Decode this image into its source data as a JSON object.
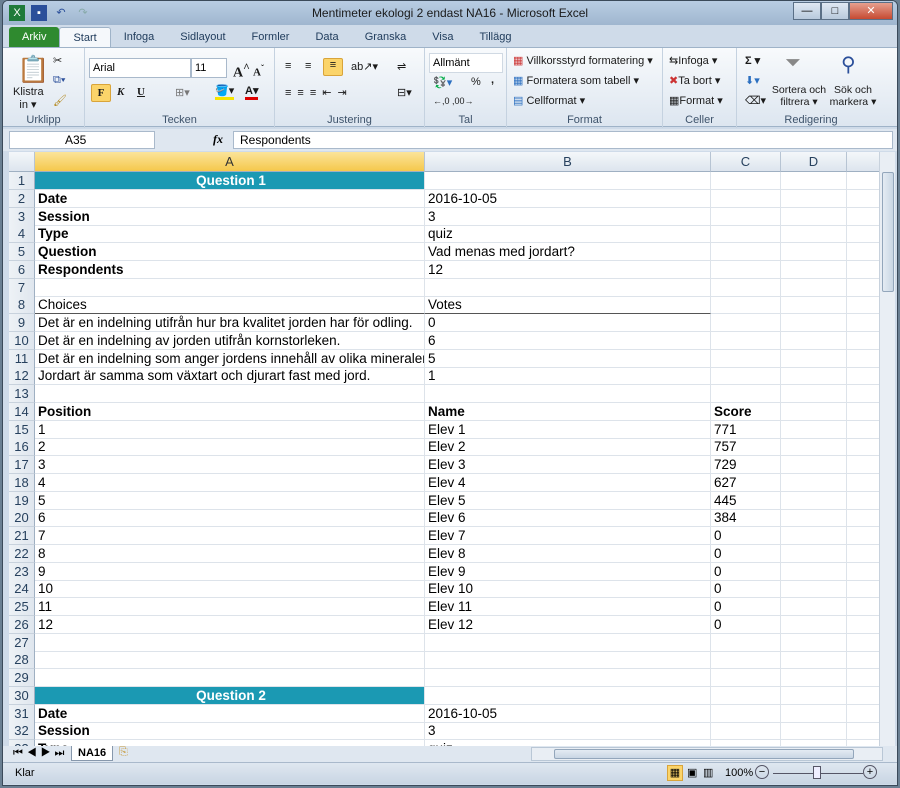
{
  "window": {
    "title": "Mentimeter ekologi 2 endast NA16  -  Microsoft Excel",
    "minimize": "—",
    "maximize": "□",
    "close": "✕"
  },
  "tabs": [
    "Arkiv",
    "Start",
    "Infoga",
    "Sidlayout",
    "Formler",
    "Data",
    "Granska",
    "Visa",
    "Tillägg"
  ],
  "ribbon": {
    "clipboard": {
      "label": "Urklipp",
      "paste": "Klistra in ▾"
    },
    "font": {
      "label": "Tecken",
      "name": "Arial",
      "size": "11",
      "bold": "F",
      "italic": "K",
      "underline": "U"
    },
    "alignment": {
      "label": "Justering"
    },
    "number": {
      "label": "Tal",
      "format": "Allmänt",
      "percent": "%",
      "comma": ","
    },
    "styles": {
      "label": "Format",
      "conditional": "Villkorsstyrd formatering ▾",
      "as_table": "Formatera som tabell ▾",
      "cell_styles": "Cellformat ▾"
    },
    "cells": {
      "label": "Celler",
      "insert": "Infoga ▾",
      "delete": "Ta bort ▾",
      "format": "Format ▾"
    },
    "editing": {
      "label": "Redigering",
      "sum": "Σ ▾",
      "sort": "Sortera och filtrera ▾",
      "find": "Sök och markera ▾"
    }
  },
  "formula_bar": {
    "name_box": "A35",
    "fx": "fx",
    "value": "Respondents"
  },
  "columns": [
    "A",
    "B",
    "C",
    "D"
  ],
  "rows": [
    {
      "n": "1",
      "a": "Question 1",
      "b": "",
      "c": "",
      "style": "heading"
    },
    {
      "n": "2",
      "a": "Date",
      "b": "2016-10-05",
      "c": "",
      "style": "label"
    },
    {
      "n": "3",
      "a": "Session",
      "b": "3",
      "c": "",
      "style": "label"
    },
    {
      "n": "4",
      "a": "Type",
      "b": "quiz",
      "c": "",
      "style": "label"
    },
    {
      "n": "5",
      "a": "Question",
      "b": "Vad menas med jordart?",
      "c": "",
      "style": "label"
    },
    {
      "n": "6",
      "a": "Respondents",
      "b": "12",
      "c": "",
      "style": "label"
    },
    {
      "n": "7",
      "a": "",
      "b": "",
      "c": "",
      "style": ""
    },
    {
      "n": "8",
      "a": "Choices",
      "b": "Votes",
      "c": "",
      "style": "choicehdr"
    },
    {
      "n": "9",
      "a": "Det är en indelning utifrån hur bra kvalitet jorden har för odling.",
      "b": "0",
      "c": "",
      "style": ""
    },
    {
      "n": "10",
      "a": "Det är en indelning av jorden utifrån kornstorleken.",
      "b": "6",
      "c": "",
      "style": ""
    },
    {
      "n": "11",
      "a": "Det är en indelning som anger jordens innehåll av olika mineraler",
      "b": "5",
      "c": "",
      "style": ""
    },
    {
      "n": "12",
      "a": "Jordart är samma som växtart och djurart fast med jord.",
      "b": "1",
      "c": "",
      "style": ""
    },
    {
      "n": "13",
      "a": "",
      "b": "",
      "c": "",
      "style": ""
    },
    {
      "n": "14",
      "a": "Position",
      "b": "Name",
      "c": "Score",
      "style": "bold"
    },
    {
      "n": "15",
      "a": "1",
      "b": "Elev 1",
      "c": "771",
      "style": ""
    },
    {
      "n": "16",
      "a": "2",
      "b": "Elev 2",
      "c": "757",
      "style": ""
    },
    {
      "n": "17",
      "a": "3",
      "b": "Elev 3",
      "c": "729",
      "style": ""
    },
    {
      "n": "18",
      "a": "4",
      "b": "Elev 4",
      "c": "627",
      "style": ""
    },
    {
      "n": "19",
      "a": "5",
      "b": "Elev 5",
      "c": "445",
      "style": ""
    },
    {
      "n": "20",
      "a": "6",
      "b": "Elev 6",
      "c": "384",
      "style": ""
    },
    {
      "n": "21",
      "a": "7",
      "b": "Elev 7",
      "c": "0",
      "style": ""
    },
    {
      "n": "22",
      "a": "8",
      "b": "Elev 8",
      "c": "0",
      "style": ""
    },
    {
      "n": "23",
      "a": "9",
      "b": "Elev 9",
      "c": "0",
      "style": ""
    },
    {
      "n": "24",
      "a": "10",
      "b": "Elev 10",
      "c": "0",
      "style": ""
    },
    {
      "n": "25",
      "a": "11",
      "b": "Elev 11",
      "c": "0",
      "style": ""
    },
    {
      "n": "26",
      "a": "12",
      "b": "Elev 12",
      "c": "0",
      "style": ""
    },
    {
      "n": "27",
      "a": "",
      "b": "",
      "c": "",
      "style": ""
    },
    {
      "n": "28",
      "a": "",
      "b": "",
      "c": "",
      "style": ""
    },
    {
      "n": "29",
      "a": "",
      "b": "",
      "c": "",
      "style": ""
    },
    {
      "n": "30",
      "a": "Question 2",
      "b": "",
      "c": "",
      "style": "heading"
    },
    {
      "n": "31",
      "a": "Date",
      "b": "2016-10-05",
      "c": "",
      "style": "label"
    },
    {
      "n": "32",
      "a": "Session",
      "b": "3",
      "c": "",
      "style": "label"
    },
    {
      "n": "33",
      "a": "Type",
      "b": "quiz",
      "c": "",
      "style": "label"
    }
  ],
  "sheet_tabs": [
    "NA16"
  ],
  "status": {
    "text": "Klar",
    "zoom": "100%",
    "zoom_minus": "−",
    "zoom_plus": "+"
  },
  "colors": {
    "heading_fill": "#1b99b3",
    "file_tab": "#2f8a2f",
    "selected_header": "#f5c84c"
  }
}
